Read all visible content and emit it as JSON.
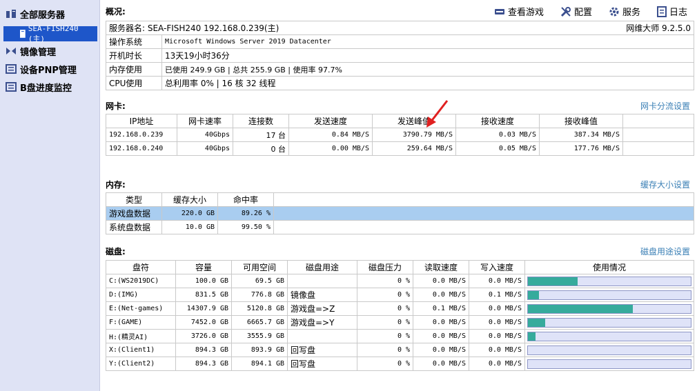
{
  "sidebar": {
    "all_servers": "全部服务器",
    "server": "SEA-FISH240 (主)",
    "image_mgmt": "镜像管理",
    "pnp_mgmt": "设备PNP管理",
    "b_progress": "B盘进度监控"
  },
  "toolbar": {
    "view_games": "查看游戏",
    "config": "配置",
    "service": "服务",
    "log": "日志"
  },
  "overview": {
    "title": "概况:",
    "server_name": "服务器名: SEA-FISH240 192.168.0.239(主)",
    "version": "网维大师 9.2.5.0",
    "rows": [
      {
        "label": "操作系统",
        "value": "Microsoft Windows Server 2019 Datacenter"
      },
      {
        "label": "开机时长",
        "value": "13天19小时36分"
      },
      {
        "label": "内存使用",
        "value": "已使用 249.9 GB | 总共 255.9 GB | 使用率 97.7%"
      },
      {
        "label": "CPU使用",
        "value": "总利用率 0% | 16 核 32 线程"
      }
    ]
  },
  "nic": {
    "title": "网卡:",
    "link": "网卡分流设置",
    "headers": [
      "IP地址",
      "网卡速率",
      "连接数",
      "发送速度",
      "发送峰值",
      "接收速度",
      "接收峰值"
    ],
    "rows": [
      [
        "192.168.0.239",
        "40Gbps",
        "17 台",
        "0.84 MB/S",
        "3790.79 MB/S",
        "0.03 MB/S",
        "387.34 MB/S"
      ],
      [
        "192.168.0.240",
        "40Gbps",
        "0 台",
        "0.00 MB/S",
        "259.64 MB/S",
        "0.05 MB/S",
        "177.76 MB/S"
      ]
    ]
  },
  "memory": {
    "title": "内存:",
    "link": "缓存大小设置",
    "headers": [
      "类型",
      "缓存大小",
      "命中率"
    ],
    "rows": [
      [
        "游戏盘数据",
        "220.0 GB",
        "89.26 %"
      ],
      [
        "系统盘数据",
        "10.0 GB",
        "99.50 %"
      ]
    ]
  },
  "disk": {
    "title": "磁盘:",
    "link": "磁盘用途设置",
    "headers": [
      "盘符",
      "容量",
      "可用空间",
      "磁盘用途",
      "磁盘压力",
      "读取速度",
      "写入速度",
      "使用情况"
    ],
    "rows": [
      {
        "cells": [
          "C:(WS2019DC)",
          "100.0 GB",
          "69.5 GB",
          "",
          "0 %",
          "0.0 MB/S",
          "0.0 MB/S"
        ],
        "usage": 0.305
      },
      {
        "cells": [
          "D:(IMG)",
          "831.5 GB",
          "776.8 GB",
          "镜像盘",
          "0 %",
          "0.0 MB/S",
          "0.1 MB/S"
        ],
        "usage": 0.066
      },
      {
        "cells": [
          "E:(Net-games)",
          "14307.9 GB",
          "5120.8 GB",
          "游戏盘=>Z",
          "0 %",
          "0.1 MB/S",
          "0.0 MB/S"
        ],
        "usage": 0.642
      },
      {
        "cells": [
          "F:(GAME)",
          "7452.0 GB",
          "6665.7 GB",
          "游戏盘=>Y",
          "0 %",
          "0.0 MB/S",
          "0.0 MB/S"
        ],
        "usage": 0.105
      },
      {
        "cells": [
          "H:(精灵AI)",
          "3726.0 GB",
          "3555.9 GB",
          "",
          "0 %",
          "0.0 MB/S",
          "0.0 MB/S"
        ],
        "usage": 0.045
      },
      {
        "cells": [
          "X:(Client1)",
          "894.3 GB",
          "893.9 GB",
          "回写盘",
          "0 %",
          "0.0 MB/S",
          "0.0 MB/S"
        ],
        "usage": 0.0
      },
      {
        "cells": [
          "Y:(Client2)",
          "894.3 GB",
          "894.1 GB",
          "回写盘",
          "0 %",
          "0.0 MB/S",
          "0.0 MB/S"
        ],
        "usage": 0.0
      }
    ]
  },
  "colors": {
    "selection": "#1e56c9",
    "bar_fill": "#36ab9c",
    "link": "#3a7fb5"
  }
}
